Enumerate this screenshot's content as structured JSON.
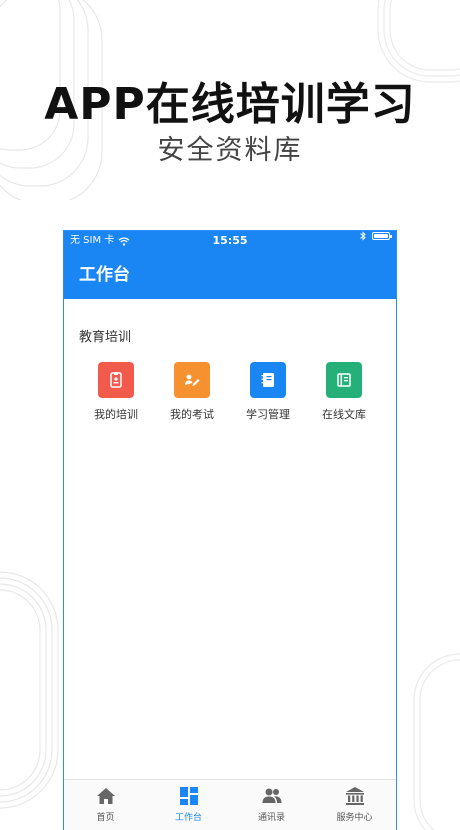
{
  "promo": {
    "title": "APP在线培训学习",
    "subtitle": "安全资料库"
  },
  "status_bar": {
    "carrier": "无 SIM 卡",
    "time": "15:55"
  },
  "header": {
    "title": "工作台"
  },
  "section": {
    "title": "教育培训",
    "items": [
      {
        "label": "我的培训",
        "icon": "badge-icon",
        "color": "#f25a4b"
      },
      {
        "label": "我的考试",
        "icon": "exam-icon",
        "color": "#f5922f"
      },
      {
        "label": "学习管理",
        "icon": "book-icon",
        "color": "#1a86f4"
      },
      {
        "label": "在线文库",
        "icon": "library-icon",
        "color": "#25b07a"
      }
    ]
  },
  "tab_bar": {
    "items": [
      {
        "label": "首页",
        "icon": "home-icon",
        "active": false
      },
      {
        "label": "工作台",
        "icon": "workbench-icon",
        "active": true
      },
      {
        "label": "通讯录",
        "icon": "contacts-icon",
        "active": false
      },
      {
        "label": "服务中心",
        "icon": "service-center-icon",
        "active": false
      }
    ]
  },
  "colors": {
    "primary": "#1a86f4",
    "tab_inactive": "#555555"
  }
}
